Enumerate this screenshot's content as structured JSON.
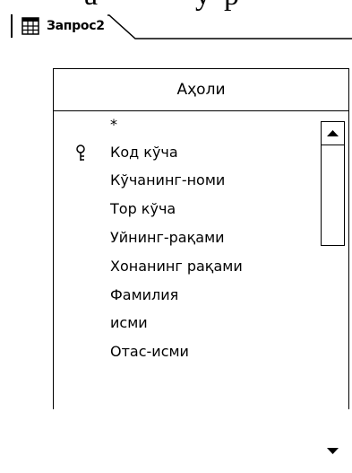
{
  "tab": {
    "label": "Запрос2"
  },
  "table": {
    "title": "Аҳоли",
    "fields": [
      {
        "label": "*",
        "primary_key": false
      },
      {
        "label": "Код кўча",
        "primary_key": true
      },
      {
        "label": "Кўчанинг-номи",
        "primary_key": false
      },
      {
        "label": "Тор кўча",
        "primary_key": false
      },
      {
        "label": "Уйнинг-рақами",
        "primary_key": false
      },
      {
        "label": "Хонанинг рақами",
        "primary_key": false
      },
      {
        "label": "Фамилия",
        "primary_key": false
      },
      {
        "label": "исми",
        "primary_key": false
      },
      {
        "label": "Отас-исми",
        "primary_key": false
      }
    ]
  },
  "icons": {
    "tab": "query-icon",
    "key": "key-icon",
    "scroll_up": "arrow-up-icon",
    "scroll_down": "arrow-down-icon"
  }
}
